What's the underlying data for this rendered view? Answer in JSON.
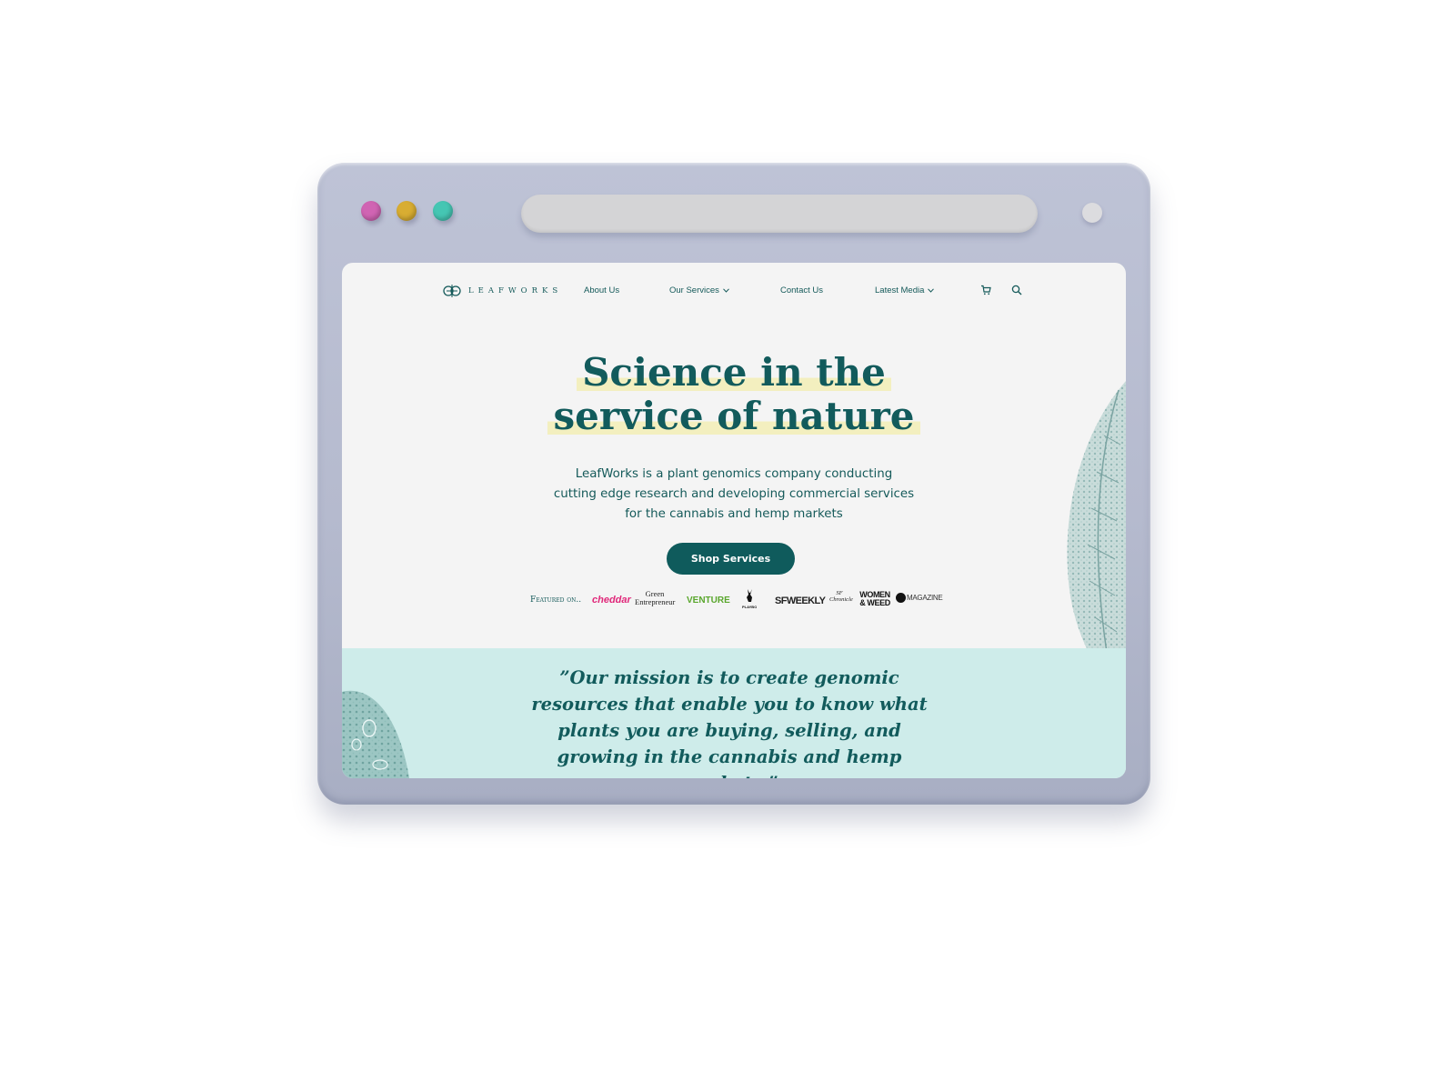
{
  "window": {
    "traffic_lights": [
      "#d064b3",
      "#d8ad32",
      "#45c6b3"
    ],
    "address": ""
  },
  "brand": {
    "name": "LeafWorks",
    "logo_text": "LEAFWORKS"
  },
  "nav": {
    "items": [
      {
        "label": "About Us",
        "has_dropdown": false
      },
      {
        "label": "Our Services",
        "has_dropdown": true
      },
      {
        "label": "Contact Us",
        "has_dropdown": false
      },
      {
        "label": "Latest Media",
        "has_dropdown": true
      }
    ],
    "icons": [
      "cart-icon",
      "search-icon"
    ]
  },
  "hero": {
    "title_line1": "Science in the",
    "title_line2": "service of nature",
    "subtitle_lines": [
      "LeafWorks is a plant genomics company conducting",
      "cutting edge research and developing commercial services",
      "for the cannabis and hemp markets"
    ],
    "cta_label": "Shop Services"
  },
  "featured": {
    "label": "Featured on..",
    "outlets": [
      "cheddar",
      "Green Entrepreneur",
      "VENTURE",
      "PLAYBOY",
      "SFWEEKLY",
      "SF Chronicle",
      "WOMEN & WEED",
      "MAGAZINE"
    ]
  },
  "mission": {
    "quote": "”Our mission is to create genomic resources that enable you to know what plants you are buying, selling, and growing in the cannabis and hemp markets.”"
  },
  "colors": {
    "brand_teal": "#125b5c",
    "highlight": "#f3efbf",
    "mission_bg": "#ceecea",
    "page_bg": "#f4f4f4",
    "frame": "#b8bdd0"
  }
}
